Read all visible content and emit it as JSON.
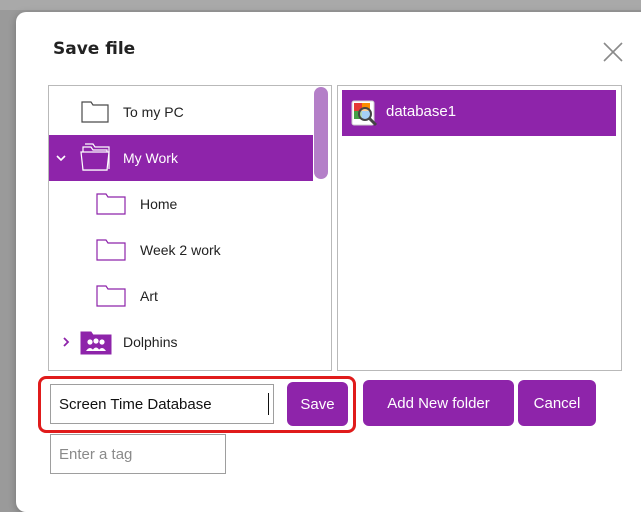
{
  "dialog": {
    "title": "Save file"
  },
  "tree": {
    "items": [
      {
        "label": "To my PC",
        "icon": "folder-icon",
        "selected": false,
        "expander": ""
      },
      {
        "label": "My Work",
        "icon": "open-folder-icon",
        "selected": true,
        "expander": "chevron-down-icon"
      },
      {
        "label": "Home",
        "icon": "folder-icon",
        "selected": false,
        "expander": ""
      },
      {
        "label": "Week 2 work",
        "icon": "folder-icon",
        "selected": false,
        "expander": ""
      },
      {
        "label": "Art",
        "icon": "folder-icon",
        "selected": false,
        "expander": ""
      },
      {
        "label": "Dolphins",
        "icon": "group-folder-icon",
        "selected": false,
        "expander": "chevron-right-icon"
      }
    ]
  },
  "files": {
    "items": [
      {
        "label": "database1",
        "icon": "database-file-icon",
        "selected": true
      }
    ]
  },
  "form": {
    "filename_value": "Screen Time Database",
    "save_label": "Save",
    "add_folder_label": "Add New folder",
    "cancel_label": "Cancel",
    "tag_placeholder": "Enter a tag"
  },
  "colors": {
    "accent": "#8e24aa",
    "highlight": "#e01b1b"
  }
}
